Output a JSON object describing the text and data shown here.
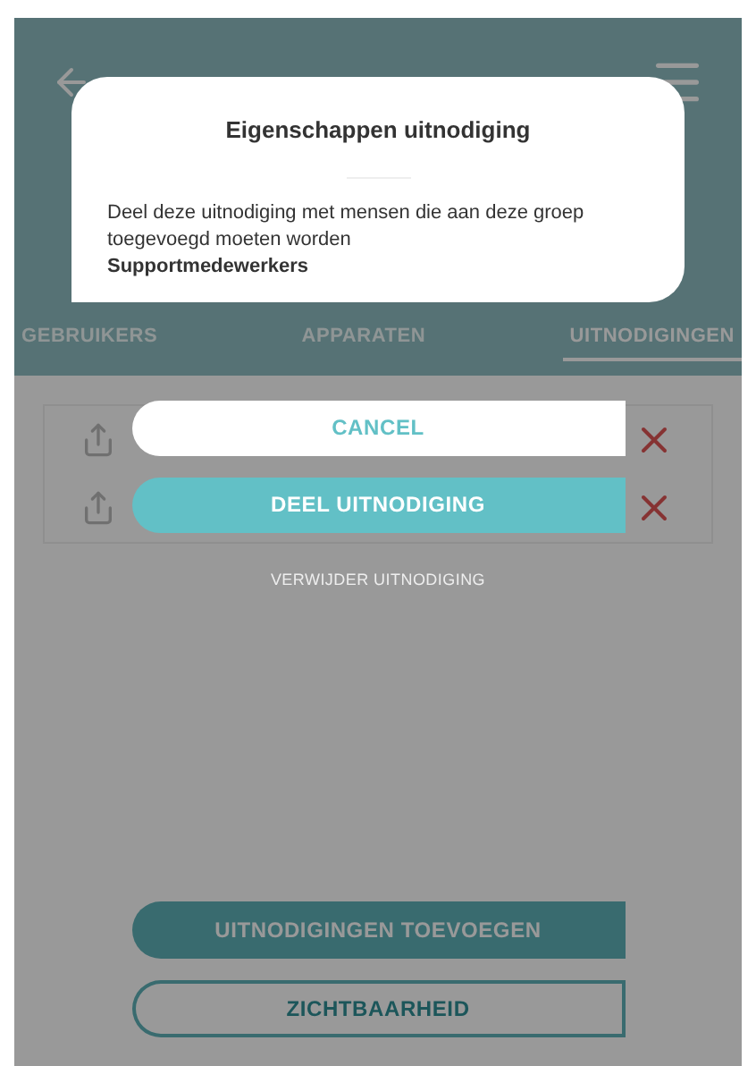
{
  "header": {
    "tabs": [
      {
        "label": "GEBRUIKERS",
        "selected": false
      },
      {
        "label": "APPARATEN",
        "selected": false
      },
      {
        "label": "UITNODIGINGEN",
        "selected": true
      }
    ]
  },
  "bottom_buttons": [
    {
      "label": "UITNODIGINGEN TOEVOEGEN",
      "kind": "filled"
    },
    {
      "label": "ZICHTBAARHEID",
      "kind": "outline"
    }
  ],
  "dialog": {
    "title": "Eigenschappen uitnodiging",
    "message": "Deel deze uitnodiging met mensen die aan deze groep toegevoegd moeten worden",
    "group": "Supportmedewerkers",
    "buttons": [
      {
        "label": "CANCEL",
        "kind": "outline"
      },
      {
        "label": "DEEL UITNODIGING",
        "kind": "filled"
      }
    ],
    "link": "VERWIJDER UITNODIGING"
  }
}
